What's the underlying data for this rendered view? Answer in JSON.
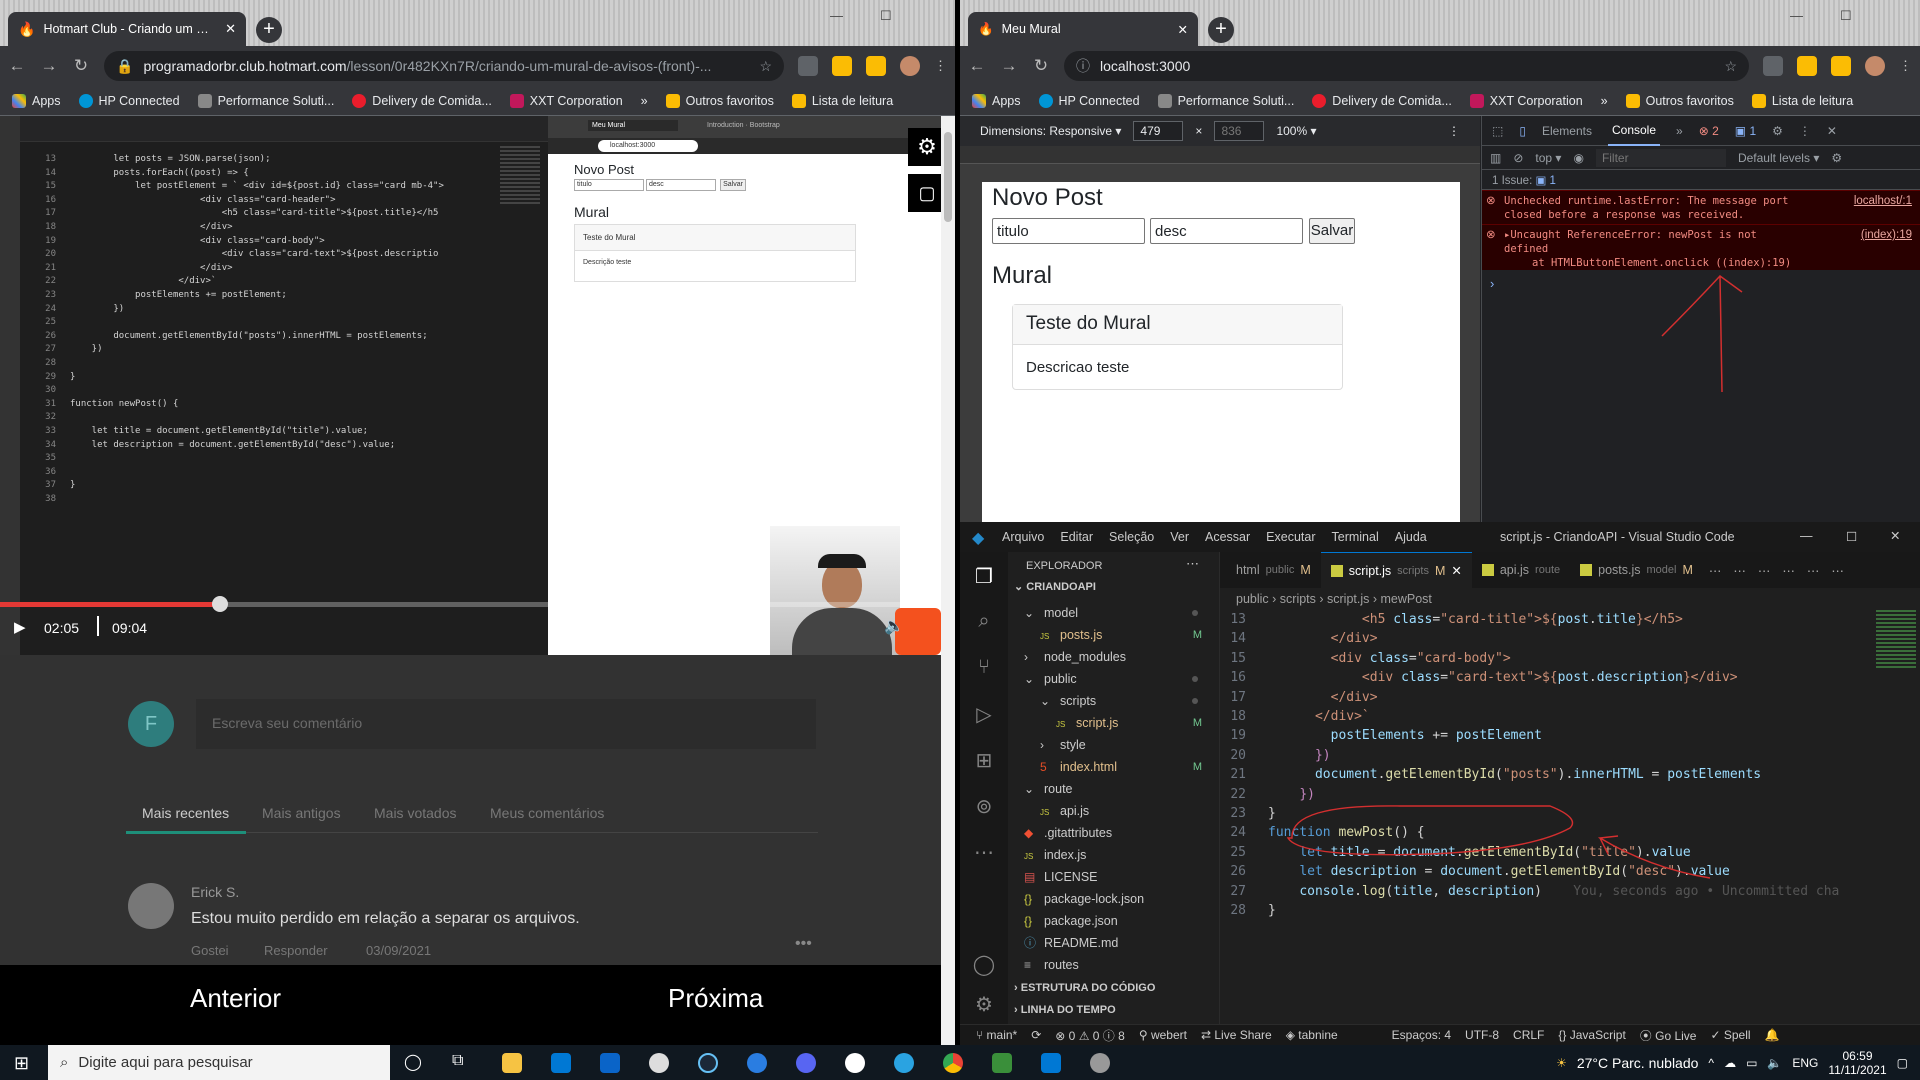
{
  "left_window": {
    "tab_title": "Hotmart Club - Criando um Mural",
    "url_domain": "programadorbr.club.hotmart.com",
    "url_path": "/lesson/0r482KXn7R/criando-um-mural-de-avisos-(front)-...",
    "bookmarks": [
      "Apps",
      "HP Connected",
      "Performance Soluti...",
      "Delivery de Comida...",
      "XXT Corporation"
    ],
    "outros": "Outros favoritos",
    "leitura": "Lista de leitura",
    "video": {
      "current_time": "02:05",
      "duration": "09:04",
      "progress": 0.23,
      "code_lines": [
        [
          "13",
          "        let posts = JSON.parse(json);"
        ],
        [
          "14",
          "        posts.forEach((post) => {"
        ],
        [
          "15",
          "            let postElement = ` <div id=${post.id} class=\"card mb-4\">"
        ],
        [
          "16",
          "                        <div class=\"card-header\">"
        ],
        [
          "17",
          "                            <h5 class=\"card-title\">${post.title}</h5"
        ],
        [
          "18",
          "                        </div>"
        ],
        [
          "19",
          "                        <div class=\"card-body\">"
        ],
        [
          "20",
          "                            <div class=\"card-text\">${post.descriptio"
        ],
        [
          "21",
          "                        </div>"
        ],
        [
          "22",
          "                    </div>`"
        ],
        [
          "23",
          "            postElements += postElement;"
        ],
        [
          "24",
          "        })"
        ],
        [
          "25",
          ""
        ],
        [
          "26",
          "        document.getElementById(\"posts\").innerHTML = postElements;"
        ],
        [
          "27",
          "    })"
        ],
        [
          "28",
          ""
        ],
        [
          "29",
          "}"
        ],
        [
          "30",
          ""
        ],
        [
          "31",
          "function newPost() {"
        ],
        [
          "32",
          ""
        ],
        [
          "33",
          "    let title = document.getElementById(\"title\").value;"
        ],
        [
          "34",
          "    let description = document.getElementById(\"desc\").value;"
        ],
        [
          "35",
          ""
        ],
        [
          "36",
          ""
        ],
        [
          "37",
          "}"
        ],
        [
          "38",
          ""
        ]
      ],
      "preview_tab": "Meu Mural",
      "preview_tab2": "Introduction · Bootstrap",
      "preview_url": "localhost:3000",
      "preview_heading": "Novo Post",
      "preview_title_input": "titulo",
      "preview_desc_input": "desc",
      "preview_save": "Salvar",
      "preview_mural": "Mural",
      "preview_card_title": "Teste do Mural",
      "preview_card_text": "Descrição teste"
    },
    "comment_placeholder": "Escreva seu comentário",
    "avatar_letter": "F",
    "sort_tabs": [
      "Mais recentes",
      "Mais antigos",
      "Mais votados",
      "Meus comentários"
    ],
    "comment": {
      "author": "Erick S.",
      "text": "Estou muito perdido em relação a separar os arquivos.",
      "like": "Gostei",
      "reply": "Responder",
      "date": "03/09/2021"
    },
    "prev_label": "Anterior",
    "next_label": "Próxima"
  },
  "right_window": {
    "tab_title": "Meu Mural",
    "url": "localhost:3000",
    "bookmarks": [
      "Apps",
      "HP Connected",
      "Performance Soluti...",
      "Delivery de Comida...",
      "XXT Corporation"
    ],
    "outros": "Outros favoritos",
    "leitura": "Lista de leitura",
    "device_toolbar": {
      "dimensions": "Dimensions: Responsive",
      "width": "479",
      "height": "836",
      "zoom": "100%"
    },
    "page": {
      "heading": "Novo Post",
      "title_value": "titulo",
      "desc_value": "desc",
      "save_label": "Salvar",
      "mural_heading": "Mural",
      "card_title": "Teste do Mural",
      "card_text": "Descricao teste"
    },
    "devtools": {
      "tabs": [
        "Elements",
        "Console"
      ],
      "error_count": "2",
      "info_count": "1",
      "context": "top",
      "filter_placeholder": "Filter",
      "levels": "Default levels",
      "issues": "1 Issue:",
      "issues_count": "1",
      "errors": [
        {
          "text": "Unchecked runtime.lastError: The message port closed before a response was received.",
          "link": "localhost/:1"
        },
        {
          "text": "Uncaught ReferenceError: newPost is not defined",
          "detail": "at HTMLButtonElement.onclick ((index):19)",
          "link": "(index):19"
        }
      ]
    }
  },
  "vscode": {
    "menu": [
      "Arquivo",
      "Editar",
      "Seleção",
      "Ver",
      "Acessar",
      "Executar",
      "Terminal",
      "Ajuda"
    ],
    "title": "script.js - CriandoAPI - Visual Studio Code",
    "explorer_label": "EXPLORADOR",
    "project": "CRIANDOAPI",
    "tree": [
      {
        "name": "model",
        "indent": 1,
        "kind": "folder-open",
        "status": "dot"
      },
      {
        "name": "posts.js",
        "indent": 2,
        "kind": "js",
        "status": "M"
      },
      {
        "name": "node_modules",
        "indent": 1,
        "kind": "folder",
        "status": ""
      },
      {
        "name": "public",
        "indent": 1,
        "kind": "folder-open",
        "status": "dot"
      },
      {
        "name": "scripts",
        "indent": 2,
        "kind": "folder-open",
        "status": "dot"
      },
      {
        "name": "script.js",
        "indent": 3,
        "kind": "js",
        "status": "M"
      },
      {
        "name": "style",
        "indent": 2,
        "kind": "folder",
        "status": ""
      },
      {
        "name": "index.html",
        "indent": 2,
        "kind": "html",
        "status": "M"
      },
      {
        "name": "route",
        "indent": 1,
        "kind": "folder-open",
        "status": ""
      },
      {
        "name": "api.js",
        "indent": 2,
        "kind": "js",
        "status": ""
      },
      {
        "name": ".gitattributes",
        "indent": 1,
        "kind": "git",
        "status": ""
      },
      {
        "name": "index.js",
        "indent": 1,
        "kind": "js",
        "status": ""
      },
      {
        "name": "LICENSE",
        "indent": 1,
        "kind": "license",
        "status": ""
      },
      {
        "name": "package-lock.json",
        "indent": 1,
        "kind": "json",
        "status": ""
      },
      {
        "name": "package.json",
        "indent": 1,
        "kind": "json",
        "status": ""
      },
      {
        "name": "README.md",
        "indent": 1,
        "kind": "info",
        "status": ""
      },
      {
        "name": "routes",
        "indent": 1,
        "kind": "file",
        "status": ""
      }
    ],
    "outline": "ESTRUTURA DO CÓDIGO",
    "timeline": "LINHA DO TEMPO",
    "tabs": [
      {
        "name": "html",
        "path": "public",
        "status": "M",
        "active": false
      },
      {
        "name": "script.js",
        "path": "scripts",
        "status": "M",
        "active": true
      },
      {
        "name": "api.js",
        "path": "route",
        "status": "",
        "active": false
      },
      {
        "name": "posts.js",
        "path": "model",
        "status": "M",
        "active": false
      }
    ],
    "breadcrumb": [
      "public",
      "scripts",
      "script.js",
      "mewPost"
    ],
    "blame": "You, seconds ago • Uncommitted cha",
    "status": {
      "branch": "main*",
      "problems": "⊗ 0 ⚠ 0 ⓘ 8",
      "user": "webert",
      "liveshare": "Live Share",
      "tabnine": "tabnine",
      "spaces": "Espaços: 4",
      "encoding": "UTF-8",
      "eol": "CRLF",
      "language": "JavaScript",
      "golive": "Go Live",
      "spell": "Spell"
    }
  },
  "taskbar": {
    "search_placeholder": "Digite aqui para pesquisar",
    "weather": "27°C  Parc. nublado",
    "lang": "ENG",
    "time": "06:59",
    "date": "11/11/2021"
  },
  "colors": {
    "accent_red": "#e53935",
    "vscode_blue": "#0078d4",
    "annotation": "#d32f2f"
  }
}
